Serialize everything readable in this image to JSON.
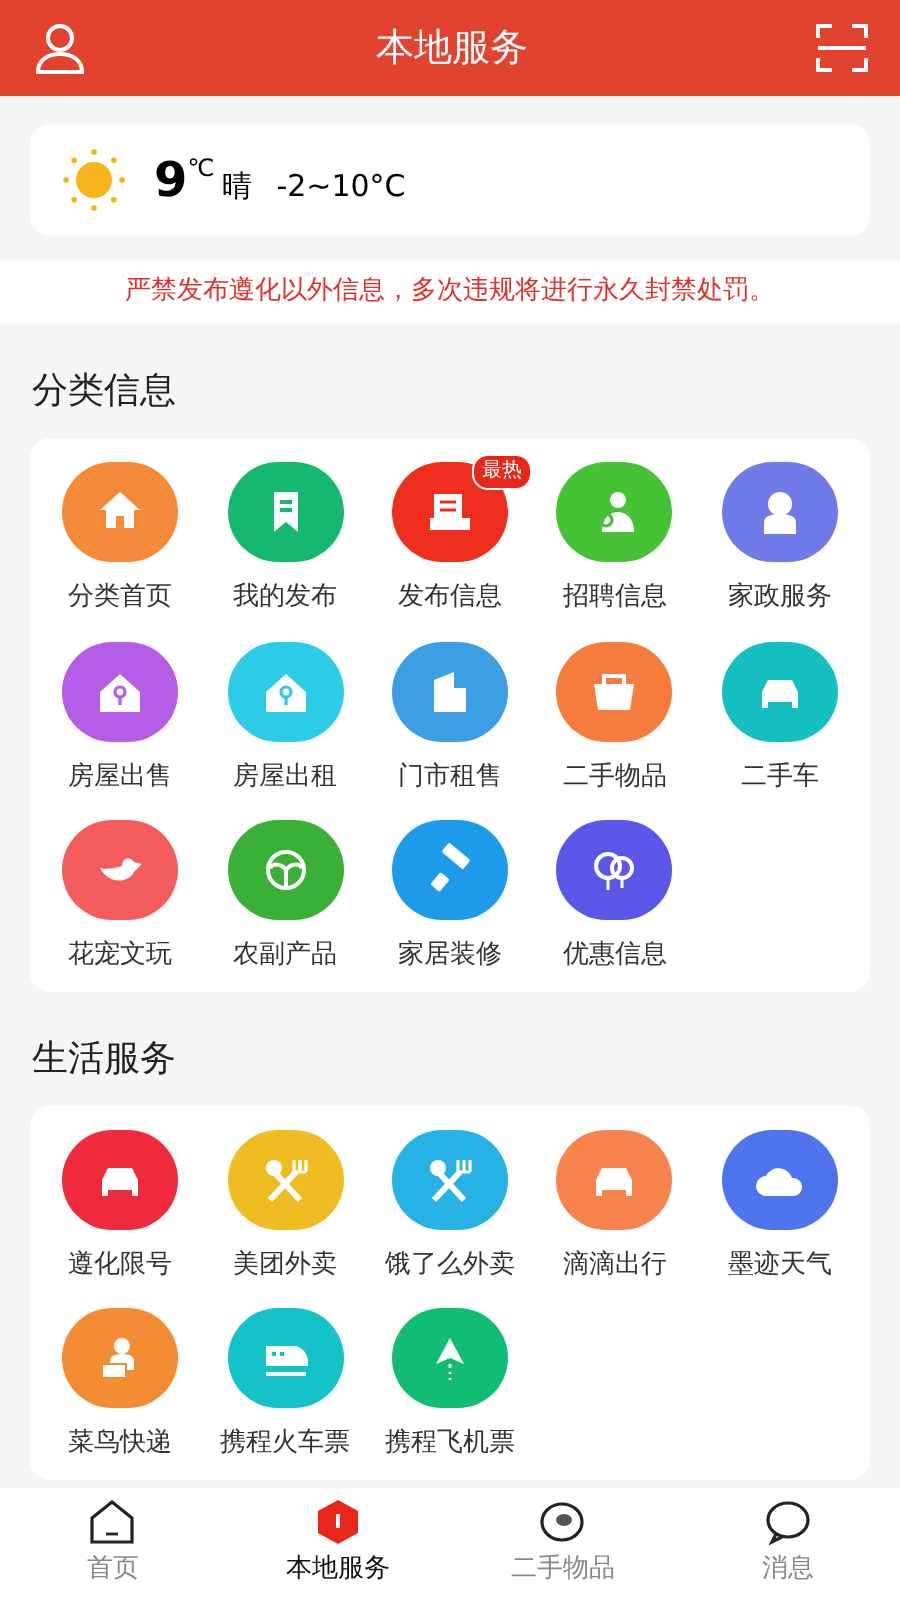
{
  "header": {
    "title": "本地服务"
  },
  "weather": {
    "temperature": "9",
    "unit": "℃",
    "condition": "晴",
    "range": "-2~10°C"
  },
  "notice": "严禁发布遵化以外信息，多次违规将进行永久封禁处罚。",
  "sections": [
    {
      "title": "分类信息",
      "items": [
        {
          "label": "分类首页"
        },
        {
          "label": "我的发布"
        },
        {
          "label": "发布信息",
          "badge": "最热"
        },
        {
          "label": "招聘信息"
        },
        {
          "label": "家政服务"
        },
        {
          "label": "房屋出售"
        },
        {
          "label": "房屋出租"
        },
        {
          "label": "门市租售"
        },
        {
          "label": "二手物品"
        },
        {
          "label": "二手车"
        },
        {
          "label": "花宠文玩"
        },
        {
          "label": "农副产品"
        },
        {
          "label": "家居装修"
        },
        {
          "label": "优惠信息"
        }
      ]
    },
    {
      "title": "生活服务",
      "items": [
        {
          "label": "遵化限号"
        },
        {
          "label": "美团外卖"
        },
        {
          "label": "饿了么外卖"
        },
        {
          "label": "滴滴出行"
        },
        {
          "label": "墨迹天气"
        },
        {
          "label": "菜鸟快递"
        },
        {
          "label": "携程火车票"
        },
        {
          "label": "携程飞机票"
        }
      ]
    }
  ],
  "tabs": [
    {
      "label": "首页",
      "selected": false
    },
    {
      "label": "本地服务",
      "selected": true
    },
    {
      "label": "二手物品",
      "selected": false
    },
    {
      "label": "消息",
      "selected": false
    }
  ]
}
